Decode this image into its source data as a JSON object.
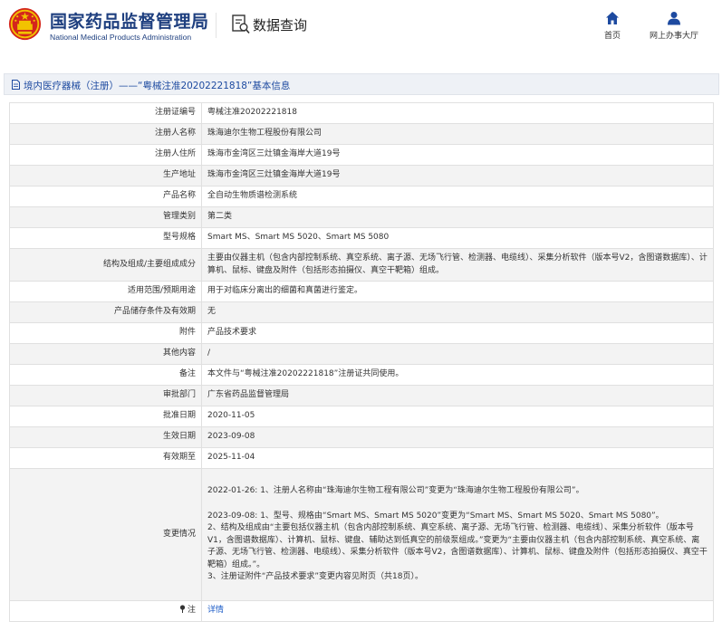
{
  "header": {
    "brand_cn": "国家药品监督管理局",
    "brand_en": "National Medical Products Administration",
    "section_title": "数据查询",
    "nav": [
      {
        "label": "首页",
        "icon": "home-icon"
      },
      {
        "label": "网上办事大厅",
        "icon": "user-icon"
      }
    ]
  },
  "page": {
    "title": "境内医疗器械（注册）——“粤械注准20202221818”基本信息"
  },
  "colors": {
    "brand_blue": "#1e3f7f",
    "title_blue": "#1d4aa0",
    "link_blue": "#1d5cc7",
    "emblem_red": "#d4261c",
    "emblem_gold": "#f2c200",
    "row_alt": "#f3f3f3"
  },
  "fields": [
    {
      "label": "注册证编号",
      "value": "粤械注准20202221818"
    },
    {
      "label": "注册人名称",
      "value": "珠海迪尔生物工程股份有限公司"
    },
    {
      "label": "注册人住所",
      "value": "珠海市金湾区三灶镇金海岸大道19号"
    },
    {
      "label": "生产地址",
      "value": "珠海市金湾区三灶镇金海岸大道19号"
    },
    {
      "label": "产品名称",
      "value": "全自动生物质谱检测系统"
    },
    {
      "label": "管理类别",
      "value": "第二类"
    },
    {
      "label": "型号规格",
      "value": "Smart MS、Smart MS 5020、Smart MS 5080"
    },
    {
      "label": "结构及组成/主要组成成分",
      "value": "主要由仪器主机（包含内部控制系统、真空系统、离子源、无场飞行管、检测器、电缆线）、采集分析软件（版本号V2，含图谱数据库）、计算机、鼠标、键盘及附件（包括形态拍摄仪、真空干靶箱）组成。"
    },
    {
      "label": "适用范围/预期用途",
      "value": "用于对临床分离出的细菌和真菌进行鉴定。"
    },
    {
      "label": "产品储存条件及有效期",
      "value": "无"
    },
    {
      "label": "附件",
      "value": "产品技术要求"
    },
    {
      "label": "其他内容",
      "value": "/"
    },
    {
      "label": "备注",
      "value": "本文件与“粤械注准20202221818”注册证共同使用。"
    },
    {
      "label": "审批部门",
      "value": "广东省药品监督管理局"
    },
    {
      "label": "批准日期",
      "value": "2020-11-05"
    },
    {
      "label": "生效日期",
      "value": "2023-09-08"
    },
    {
      "label": "有效期至",
      "value": "2025-11-04"
    }
  ],
  "changes": {
    "label": "变更情况",
    "entry1": "2022-01-26: 1、注册人名称由“珠海迪尔生物工程有限公司”变更为“珠海迪尔生物工程股份有限公司”。",
    "entry2_line1": "2023-09-08: 1、型号、规格由“Smart MS、Smart MS 5020”变更为“Smart MS、Smart MS 5020、Smart MS 5080”。",
    "entry2_line2": "2、结构及组成由“主要包括仪器主机（包含内部控制系统、真空系统、离子源、无场飞行管、检测器、电缆线）、采集分析软件（版本号V1，含图谱数据库）、计算机、鼠标、键盘、辅助达到低真空的前级泵组成。”变更为“主要由仪器主机（包含内部控制系统、真空系统、离子源、无场飞行管、检测器、电缆线）、采集分析软件（版本号V2，含图谱数据库）、计算机、鼠标、键盘及附件（包括形态拍摄仪、真空干靶箱）组成。”。",
    "entry2_line3": "3、注册证附件“产品技术要求”变更内容见附页（共18页）。"
  },
  "note": {
    "label": "注",
    "link": "详情",
    "icon": "pin-icon"
  }
}
